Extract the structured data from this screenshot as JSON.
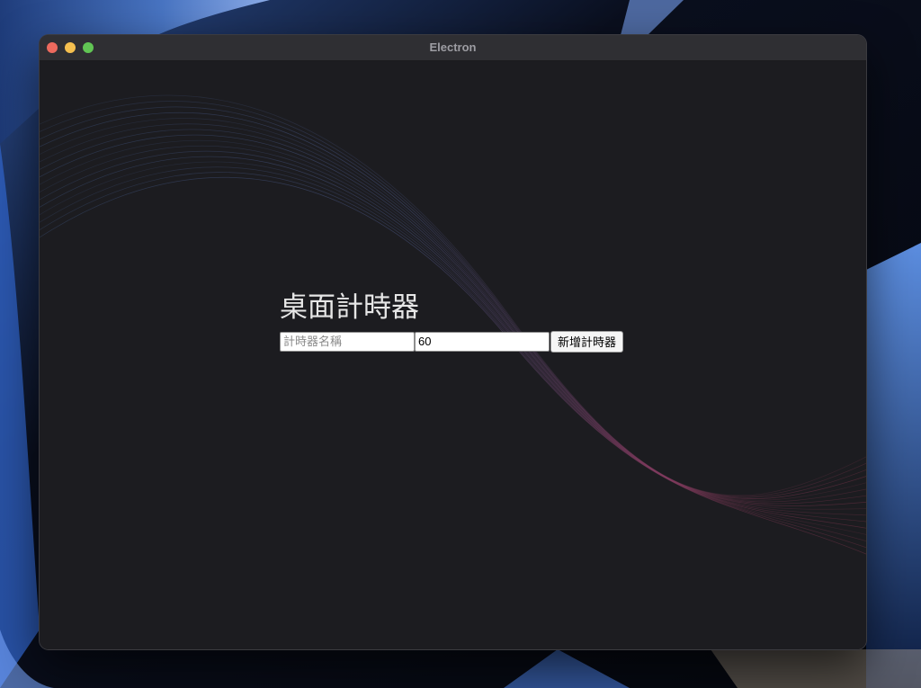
{
  "window": {
    "title": "Electron",
    "controls": {
      "close_color": "#ed6a5e",
      "minimize_color": "#f5bf4f",
      "maximize_color": "#61c554"
    }
  },
  "app": {
    "heading": "桌面計時器",
    "name_input": {
      "placeholder": "計時器名稱",
      "value": ""
    },
    "duration_input": {
      "value": "60"
    },
    "add_button_label": "新增計時器"
  },
  "colors": {
    "background": "#1c1c20",
    "titlebar": "#2f2f33",
    "wave_blue": "#4a5d8f",
    "wave_red": "#8a3a5a"
  }
}
